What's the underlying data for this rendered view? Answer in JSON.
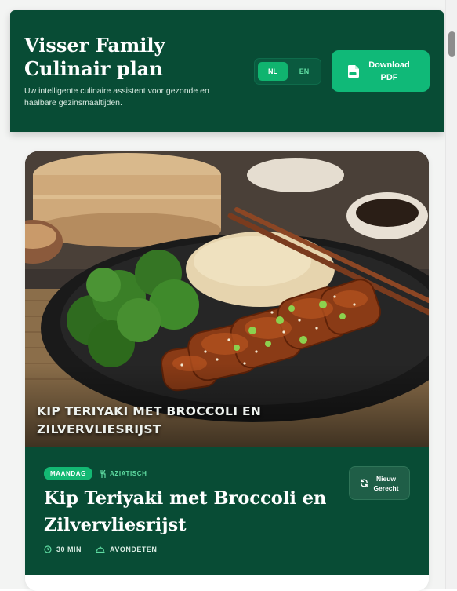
{
  "header": {
    "title": "Visser Family Culinair plan",
    "subtitle": "Uw intelligente culinaire assistent voor gezonde en haalbare gezinsmaaltijden.",
    "language": {
      "options": [
        "NL",
        "EN"
      ],
      "selected": "NL"
    },
    "download_label": "Download PDF",
    "colors": {
      "header_bg": "#084c35",
      "accent": "#10b978"
    }
  },
  "recipe_card": {
    "hero_caption": "Kip Teriyaki met Broccoli en Zilvervliesrijst",
    "day_badge": "MAANDAG",
    "cuisine": "AZIATISCH",
    "cuisine_icon": "utensils-icon",
    "title": "Kip Teriyaki met Broccoli en Zilvervliesrijst",
    "new_dish_label": "Nieuw Gerecht",
    "new_dish_icon": "refresh-icon",
    "time": "30 MIN",
    "time_icon": "clock-icon",
    "meal_type": "AVONDETEN",
    "meal_icon": "cloche-icon"
  }
}
